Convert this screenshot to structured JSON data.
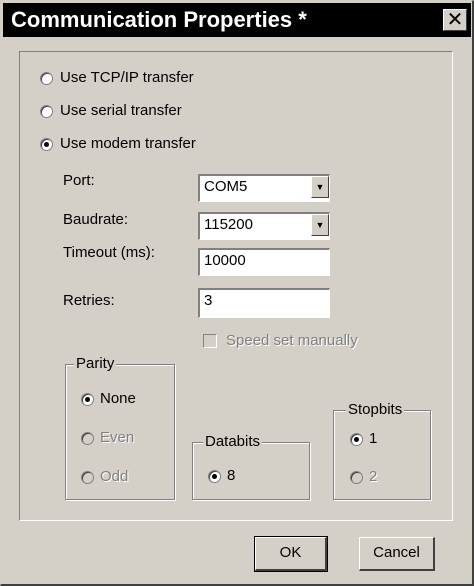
{
  "window": {
    "title": "Communication Properties *",
    "close_glyph": "✕"
  },
  "transfer": {
    "options": [
      {
        "label": "Use TCP/IP transfer",
        "checked": false
      },
      {
        "label": "Use serial transfer",
        "checked": false
      },
      {
        "label": "Use modem transfer",
        "checked": true
      }
    ]
  },
  "settings": {
    "port_label": "Port:",
    "port_value": "COM5",
    "baud_label": "Baudrate:",
    "baud_value": "115200",
    "timeout_label": "Timeout (ms):",
    "timeout_value": "10000",
    "retries_label": "Retries:",
    "retries_value": "3",
    "speed_label": "Speed set manually"
  },
  "parity": {
    "title": "Parity",
    "options": [
      {
        "label": "None",
        "checked": true,
        "enabled": true
      },
      {
        "label": "Even",
        "checked": false,
        "enabled": false
      },
      {
        "label": "Odd",
        "checked": false,
        "enabled": false
      }
    ]
  },
  "databits": {
    "title": "Databits",
    "options": [
      {
        "label": "8",
        "checked": true
      }
    ]
  },
  "stopbits": {
    "title": "Stopbits",
    "options": [
      {
        "label": "1",
        "checked": true,
        "enabled": true
      },
      {
        "label": "2",
        "checked": false,
        "enabled": false
      }
    ]
  },
  "buttons": {
    "ok": "OK",
    "cancel": "Cancel"
  }
}
